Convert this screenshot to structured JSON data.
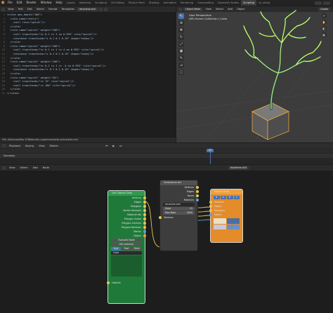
{
  "app": {
    "menus": [
      "File",
      "Edit",
      "Render",
      "Window",
      "Help"
    ],
    "workspaces": [
      "Layout",
      "Modeling",
      "Sculpting",
      "UV Editing",
      "Texture Paint",
      "Shading",
      "Animation",
      "Rendering",
      "Compositing",
      "Geometry Nodes",
      "Scripting",
      "rb_rating"
    ],
    "active_workspace": "Scripting",
    "scene_label": "Scene",
    "view_layer_label": "ViewLayer"
  },
  "text_editor": {
    "menus": [
      "View",
      "Text",
      "Edit",
      "Select",
      "Format",
      "Templates"
    ],
    "text_name": "recursive.xml",
    "lines": [
      "<rules max_depth=\"100\">",
      "  <rule name=\"entry\">",
      "    <call rule=\"spiral\"/>",
      "  </rule>",
      "  <rule name=\"spiral\" weight=\"100\">",
      "    <call transforms=\"tz 0.1 rx 1 sa 0.995\" rule=\"spiral\"/>",
      "    <instance transforms=\"s 0.1 0.1 0.15\" shape=\"tubey\"/>",
      "  </rule>",
      "  <rule name=\"spiral\" weight=\"100\">",
      "    <call transforms=\"tz 0.1 rx 1 ry 4 sa 0.995\" rule=\"spiral\"/>",
      "    <instance transforms=\"s 0.1 0.1 0.15\" shape=\"tubey\"/>",
      "  </rule>",
      "  <rule name=\"spiral\" weight=\"100\">",
      "    <call transforms=\"tz 0.1 rx 1 rz -4 sa 0.995\" rule=\"spiral\"/>",
      "    <instance transforms=\"s 0.1 0.1 0.15\" shape=\"tubey\"/>",
      "  </rule>",
      "  <rule name=\"spiral\" weight=\"20\">",
      "    <call transforms=\"rx 15\" rule=\"spiral\"/>",
      "    <call transforms=\"rz 180\" rule=\"spiral\"/>",
      "  </rule>",
      "</rules>"
    ],
    "file_path": "File: /Volumes/Mac 4TB/blender_experiments/structure/tree.xml"
  },
  "viewport": {
    "mode": "Object Mode",
    "menus": [
      "View",
      "Select",
      "Add",
      "Object"
    ],
    "perspective": "User Perspective",
    "collection": "(83) Scene Collection | Cube",
    "shading_label": "Global"
  },
  "timeline": {
    "menus": [
      "Playback",
      "Keying",
      "View",
      "Marker"
    ],
    "current_frame": "83",
    "summary": "Summary"
  },
  "node_editor": {
    "menus": [
      "View",
      "Select",
      "Add",
      "Node"
    ],
    "tree_name": "NodeTree.003",
    "get_objects": {
      "title": "Get Objects Data",
      "outputs": [
        "Vertices",
        "Edges",
        "Polygons",
        "Vertex Normals",
        "Material Idx",
        "Polygon Areas",
        "Polygon Centers",
        "Polygon Normals",
        "Matrix",
        "Object"
      ],
      "evaluate_label": "Evaluate Node",
      "get_selection_label": "Get selection",
      "sort_label": "Sort",
      "post_label": "Post",
      "mesh_label": "Mesh",
      "object_field": "Cube",
      "bottom_socket": "Objects"
    },
    "generative": {
      "title": "Generative Art",
      "outputs": [
        "Vertices",
        "Edges",
        "Faces",
        "Matrices"
      ],
      "file_label": "recursive.xml",
      "param_a_label": "Seed",
      "param_a_value": "21",
      "param_b_label": "Max Mats",
      "param_b_value": "5000",
      "inputs": [
        "Vertices"
      ]
    },
    "viewer": {
      "title": "Viewer Draw",
      "inputs": [
        "Vertices",
        "Edges",
        "Polygons",
        "Matrix"
      ],
      "toggles": [
        "B",
        "A",
        "B",
        "E"
      ]
    }
  },
  "colors": {
    "accent": "#4772b3",
    "node_green": "#1f7a3a",
    "node_orange": "#e48b2a",
    "socket_yellow": "#e8c84a",
    "socket_orange": "#e89a3a",
    "mesh_outline": "#f2f26a"
  }
}
